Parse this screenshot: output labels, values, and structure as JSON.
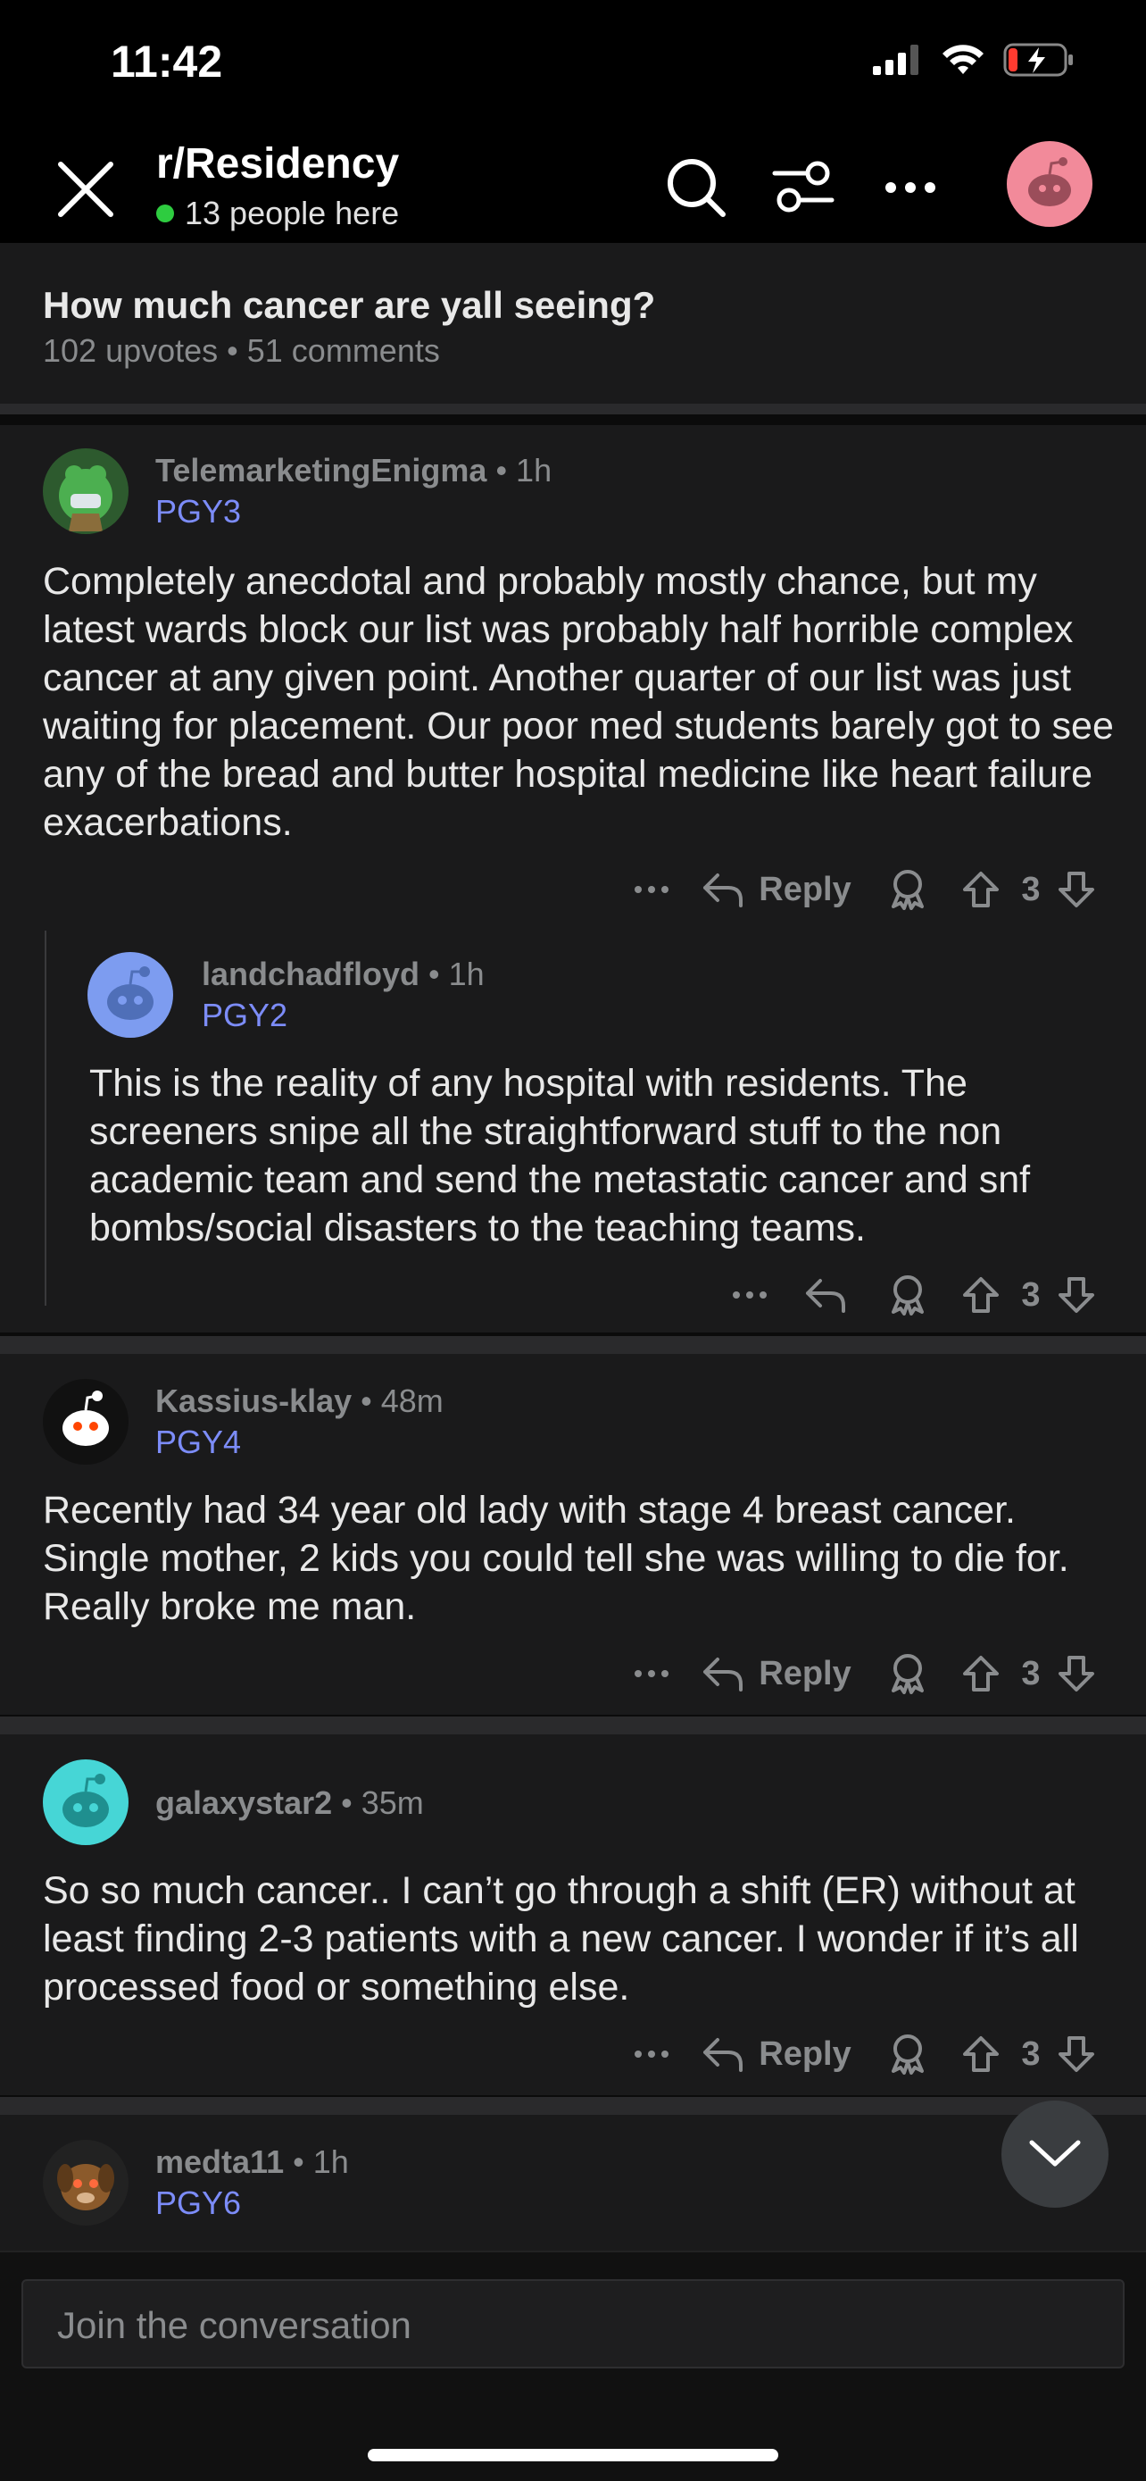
{
  "status": {
    "time": "11:42"
  },
  "header": {
    "subreddit": "r/Residency",
    "online": "13 people here"
  },
  "post": {
    "title": "How much cancer are yall seeing?",
    "meta": "102 upvotes • 51 comments"
  },
  "comments": [
    {
      "user": "TelemarketingEnigma",
      "time": " • 1h",
      "flair": "PGY3",
      "body": "Completely anecdotal and probably mostly chance, but my latest wards block our list was probably half horrible complex cancer at any given point. Another quarter of our list was just waiting for placement. Our poor med students barely got to see any of the bread and butter hospital medicine like heart failure exacerbations.",
      "reply": "Reply",
      "score": "3"
    },
    {
      "user": "landchadfloyd",
      "time": " • 1h",
      "flair": "PGY2",
      "body": "This is the reality of any hospital with residents. The screeners snipe all the straightforward stuff to the non academic team and send the metastatic cancer and snf bombs/social disasters to the teaching teams.",
      "score": "3"
    },
    {
      "user": "Kassius-klay",
      "time": " • 48m",
      "flair": "PGY4",
      "body": "Recently had 34 year old lady with stage 4 breast cancer. Single mother, 2 kids you could tell she was willing to die for. Really broke me man.",
      "reply": "Reply",
      "score": "3"
    },
    {
      "user": "galaxystar2",
      "time": " • 35m",
      "flair": "",
      "body": "So so much cancer.. I can’t go  through a shift (ER) without at least finding 2-3 patients with a new  cancer.  I wonder if it’s all processed food or something else.",
      "reply": "Reply",
      "score": "3"
    },
    {
      "user": "medta11",
      "time": " • 1h",
      "flair": "PGY6"
    }
  ],
  "composer": {
    "placeholder": "Join the conversation"
  },
  "colors": {
    "flair": "#7c8cf8",
    "online_dot": "#2ecc40",
    "avatar_top": "#f28a9a"
  }
}
